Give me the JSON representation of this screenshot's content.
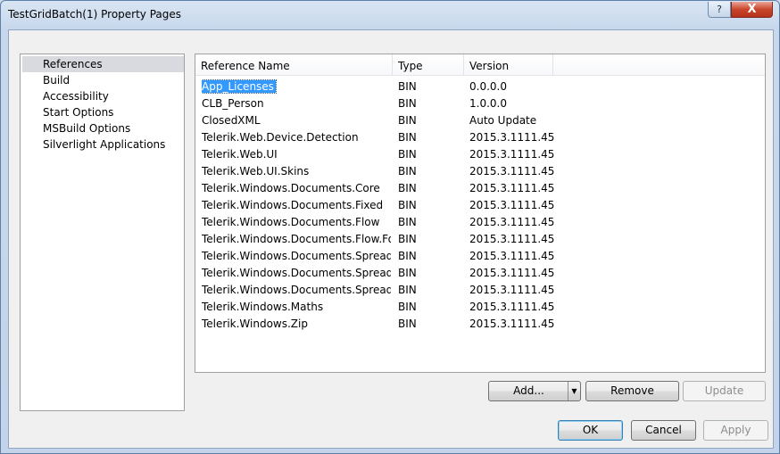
{
  "window": {
    "title": "TestGridBatch(1) Property Pages",
    "help_glyph": "?",
    "close_glyph": "X"
  },
  "nav": {
    "items": [
      {
        "label": "References",
        "selected": true
      },
      {
        "label": "Build"
      },
      {
        "label": "Accessibility"
      },
      {
        "label": "Start Options"
      },
      {
        "label": "MSBuild Options"
      },
      {
        "label": "Silverlight Applications"
      }
    ]
  },
  "references": {
    "columns": [
      "Reference Name",
      "Type",
      "Version"
    ],
    "rows": [
      {
        "name": "App_Licenses",
        "type": "BIN",
        "version": "0.0.0.0",
        "selected": true
      },
      {
        "name": "CLB_Person",
        "type": "BIN",
        "version": "1.0.0.0"
      },
      {
        "name": "ClosedXML",
        "type": "BIN",
        "version": "Auto Update"
      },
      {
        "name": "Telerik.Web.Device.Detection",
        "type": "BIN",
        "version": "2015.3.1111.45"
      },
      {
        "name": "Telerik.Web.UI",
        "type": "BIN",
        "version": "2015.3.1111.45"
      },
      {
        "name": "Telerik.Web.UI.Skins",
        "type": "BIN",
        "version": "2015.3.1111.45"
      },
      {
        "name": "Telerik.Windows.Documents.Core",
        "type": "BIN",
        "version": "2015.3.1111.45"
      },
      {
        "name": "Telerik.Windows.Documents.Fixed",
        "type": "BIN",
        "version": "2015.3.1111.45"
      },
      {
        "name": "Telerik.Windows.Documents.Flow",
        "type": "BIN",
        "version": "2015.3.1111.45"
      },
      {
        "name": "Telerik.Windows.Documents.Flow.For...",
        "type": "BIN",
        "version": "2015.3.1111.45"
      },
      {
        "name": "Telerik.Windows.Documents.Spreadsh...",
        "type": "BIN",
        "version": "2015.3.1111.45"
      },
      {
        "name": "Telerik.Windows.Documents.Spreadsh...",
        "type": "BIN",
        "version": "2015.3.1111.45"
      },
      {
        "name": "Telerik.Windows.Documents.Spreadsh...",
        "type": "BIN",
        "version": "2015.3.1111.45"
      },
      {
        "name": "Telerik.Windows.Maths",
        "type": "BIN",
        "version": "2015.3.1111.45"
      },
      {
        "name": "Telerik.Windows.Zip",
        "type": "BIN",
        "version": "2015.3.1111.45"
      }
    ]
  },
  "buttons": {
    "add": "Add...",
    "add_arrow": "▼",
    "remove": "Remove",
    "update": "Update",
    "ok": "OK",
    "cancel": "Cancel",
    "apply": "Apply"
  },
  "colors": {
    "selection": "#3399ff",
    "nav_selected": "#d9d9e0"
  }
}
